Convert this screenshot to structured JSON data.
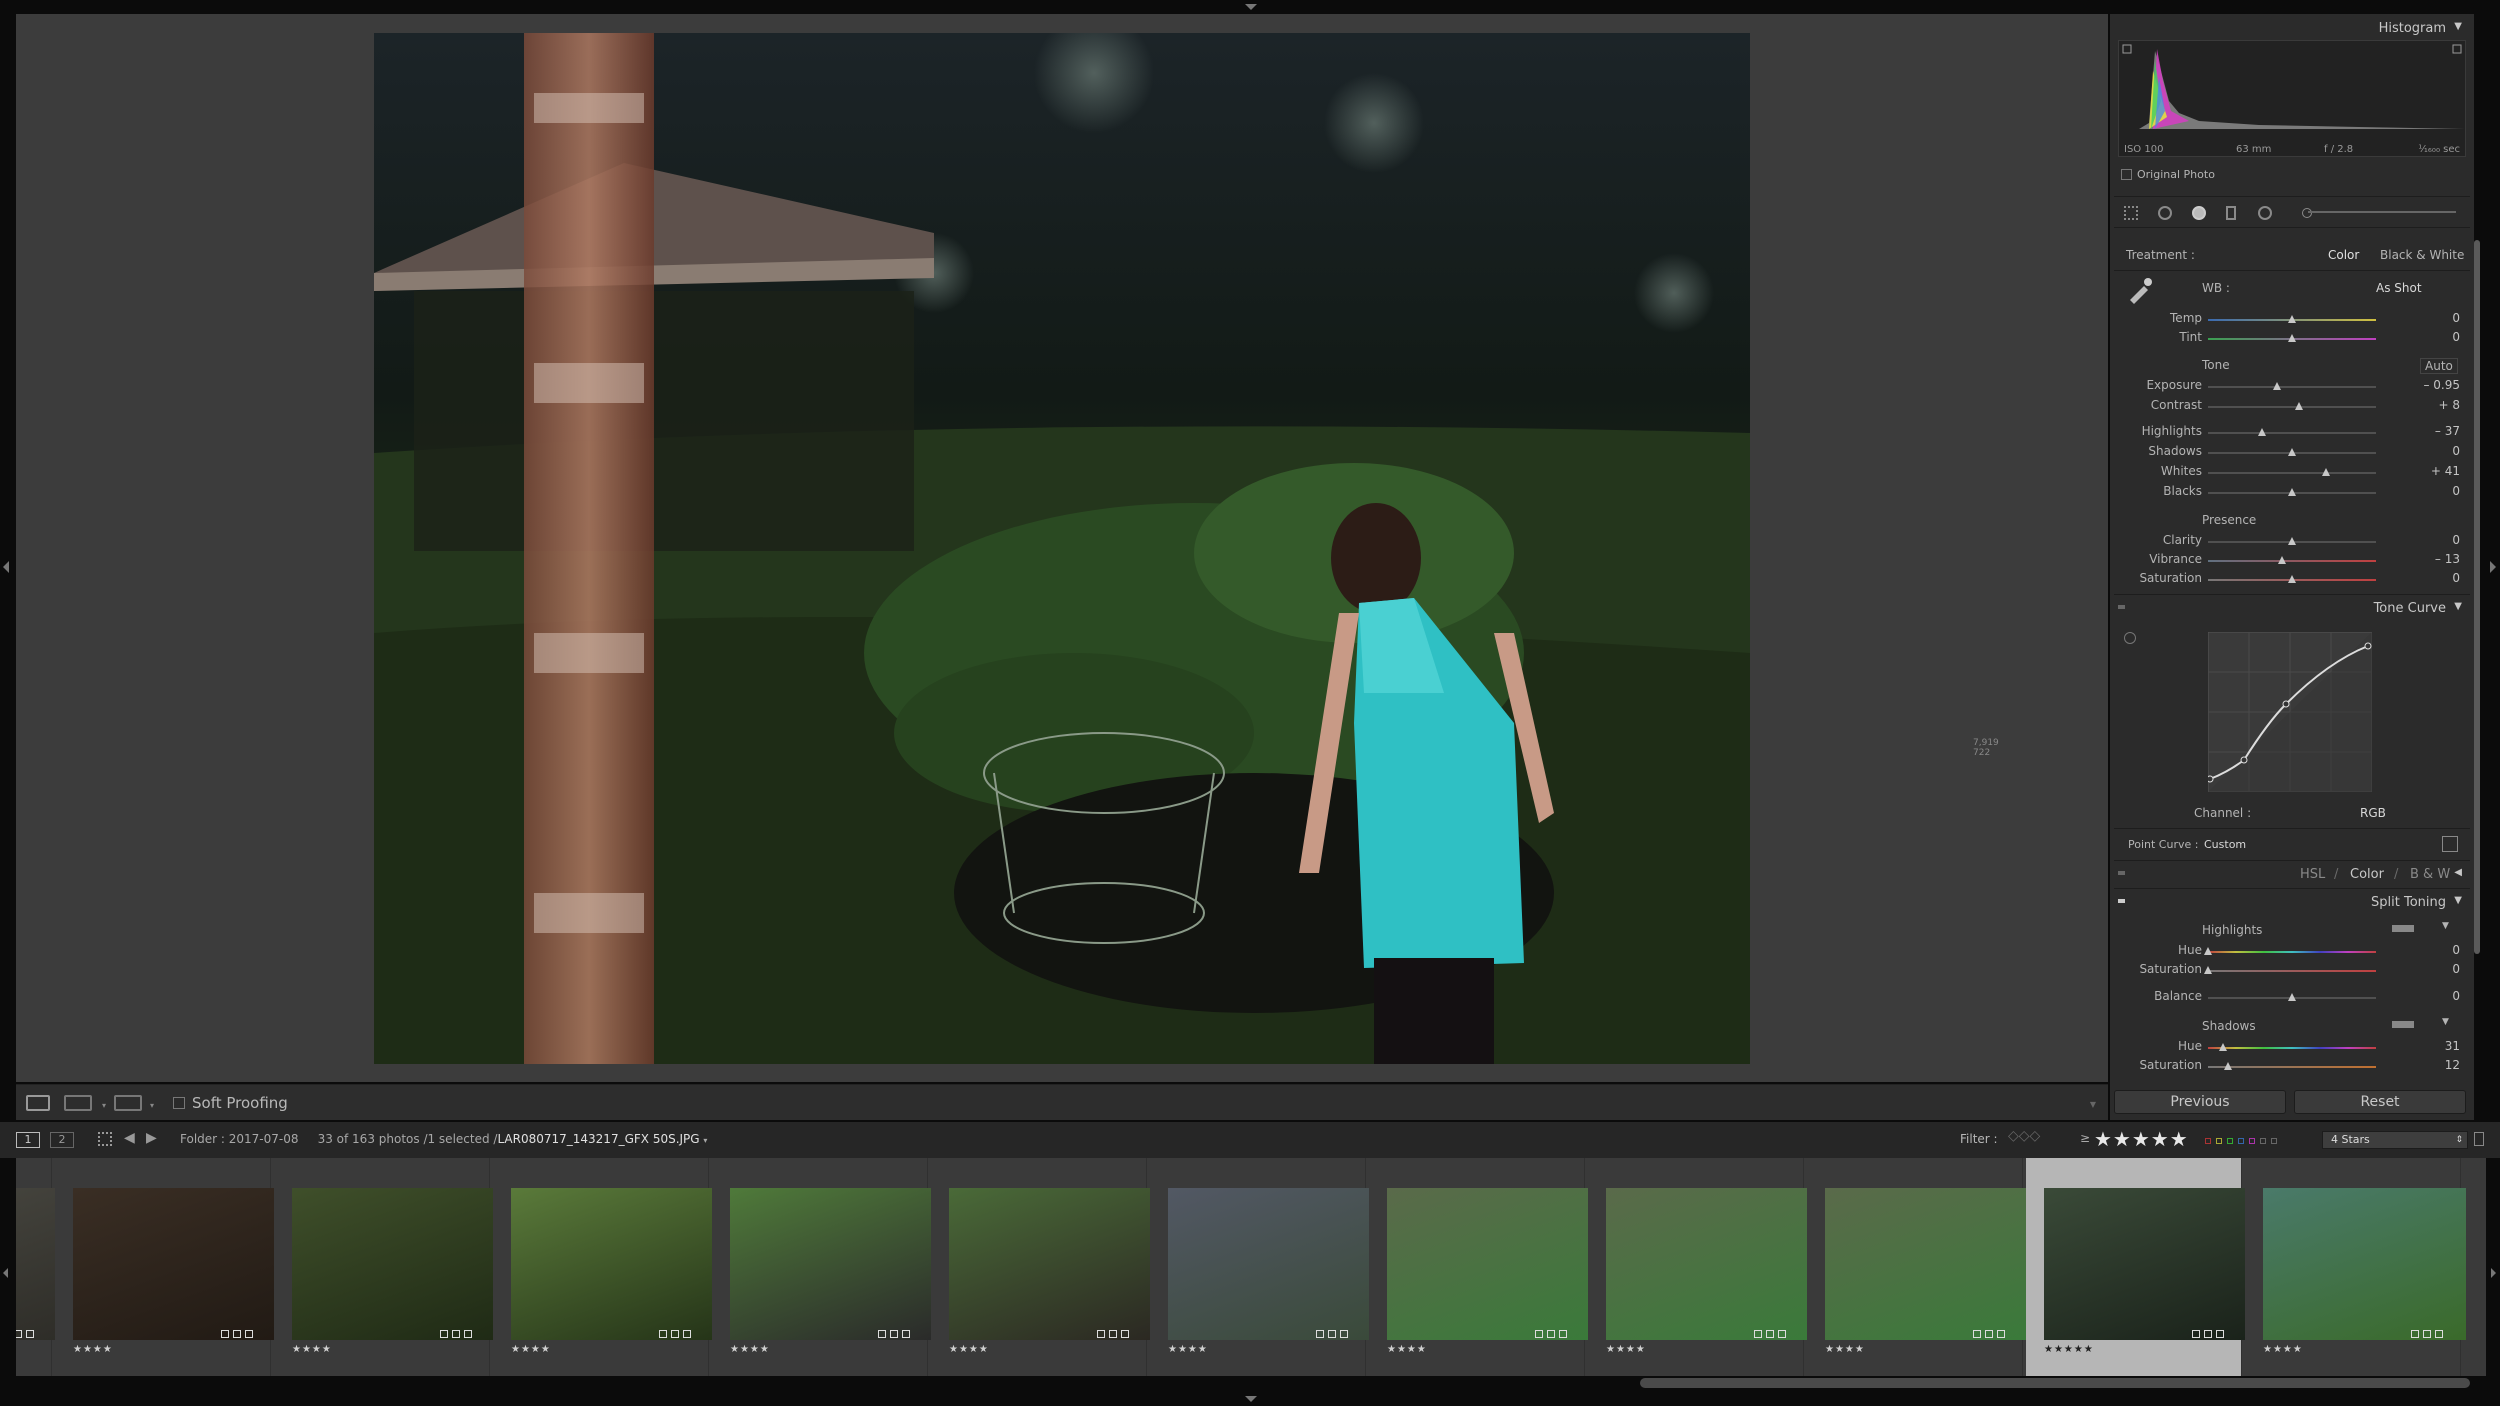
{
  "soft_proofing_label": "Soft Proofing",
  "coord_readout": "7,919\n722",
  "right_panel": {
    "histogram": {
      "title": "Histogram",
      "iso": "ISO 100",
      "focal": "63 mm",
      "aperture": "f / 2.8",
      "shutter": "¹⁄₁₆₀₀ sec",
      "original_photo": "Original Photo"
    },
    "basic": {
      "treatment_label": "Treatment :",
      "treatment_color": "Color",
      "treatment_bw": "Black & White",
      "wb_label": "WB :",
      "wb_value": "As Shot",
      "tone_label": "Tone",
      "auto_label": "Auto",
      "presence_label": "Presence",
      "sliders": [
        {
          "label": "Temp",
          "value": "0",
          "pos": 0.5
        },
        {
          "label": "Tint",
          "value": "0",
          "pos": 0.5
        },
        {
          "label": "Exposure",
          "value": "– 0.95",
          "pos": 0.41
        },
        {
          "label": "Contrast",
          "value": "+ 8",
          "pos": 0.54
        },
        {
          "label": "Highlights",
          "value": "– 37",
          "pos": 0.32
        },
        {
          "label": "Shadows",
          "value": "0",
          "pos": 0.5
        },
        {
          "label": "Whites",
          "value": "+ 41",
          "pos": 0.7
        },
        {
          "label": "Blacks",
          "value": "0",
          "pos": 0.5
        },
        {
          "label": "Clarity",
          "value": "0",
          "pos": 0.5
        },
        {
          "label": "Vibrance",
          "value": "– 13",
          "pos": 0.44
        },
        {
          "label": "Saturation",
          "value": "0",
          "pos": 0.5
        }
      ]
    },
    "tone_curve": {
      "title": "Tone Curve",
      "channel_label": "Channel :",
      "channel_value": "RGB",
      "point_curve_label": "Point Curve :",
      "point_curve_value": "Custom"
    },
    "hsl_nav": {
      "hsl": "HSL",
      "slash1": "/",
      "color": "Color",
      "slash2": "/",
      "bw": "B & W"
    },
    "split_toning": {
      "title": "Split Toning",
      "highlights_label": "Highlights",
      "shadows_label": "Shadows",
      "sliders": [
        {
          "label": "Hue",
          "value": "0",
          "pos": 0.0
        },
        {
          "label": "Saturation",
          "value": "0",
          "pos": 0.0
        },
        {
          "label": "Balance",
          "value": "0",
          "pos": 0.5
        },
        {
          "label": "Hue",
          "value": "31",
          "pos": 0.09
        },
        {
          "label": "Saturation",
          "value": "12",
          "pos": 0.12
        }
      ]
    },
    "buttons": {
      "previous": "Previous",
      "reset": "Reset"
    }
  },
  "filmstrip_bar": {
    "page1": "1",
    "page2": "2",
    "folder": "Folder : 2017-07-08",
    "count": "33 of 163 photos /1 selected /",
    "filename": "LAR080717_143217_GFX 50S.JPG",
    "filter_label": "Filter :",
    "filter_op": "≥",
    "filter_stars": "★★★★★",
    "filter_value": "4 Stars"
  },
  "filmstrip": [
    {
      "stars": "",
      "selected": false,
      "c1": "#4b4a43",
      "c2": "#2e2d28"
    },
    {
      "stars": "★★★★",
      "selected": false,
      "c1": "#3a2e24",
      "c2": "#211a14"
    },
    {
      "stars": "★★★★",
      "selected": false,
      "c1": "#3f4f2a",
      "c2": "#1f2a15"
    },
    {
      "stars": "★★★★",
      "selected": false,
      "c1": "#5a7a3a",
      "c2": "#253418"
    },
    {
      "stars": "★★★★",
      "selected": false,
      "c1": "#4f7a3a",
      "c2": "#2a2a2a"
    },
    {
      "stars": "★★★★",
      "selected": false,
      "c1": "#4a6a38",
      "c2": "#2b2822"
    },
    {
      "stars": "★★★★",
      "selected": false,
      "c1": "#525864",
      "c2": "#3a4a3a"
    },
    {
      "stars": "★★★★",
      "selected": false,
      "c1": "#5a6a4a",
      "c2": "#3a7a3a"
    },
    {
      "stars": "★★★★",
      "selected": false,
      "c1": "#5a6a4a",
      "c2": "#3a7a3a"
    },
    {
      "stars": "★★★★",
      "selected": false,
      "c1": "#5a6a4a",
      "c2": "#3a7a3a"
    },
    {
      "stars": "★★★★★",
      "selected": true,
      "c1": "#3a4a38",
      "c2": "#1a221a"
    },
    {
      "stars": "★★★★",
      "selected": false,
      "c1": "#4a7a6a",
      "c2": "#3a6a2a"
    }
  ],
  "colors": {
    "accent_selected": "#b6b6b6",
    "panel_bg": "#2b2b2b",
    "center_bg": "#3c3c3c"
  }
}
